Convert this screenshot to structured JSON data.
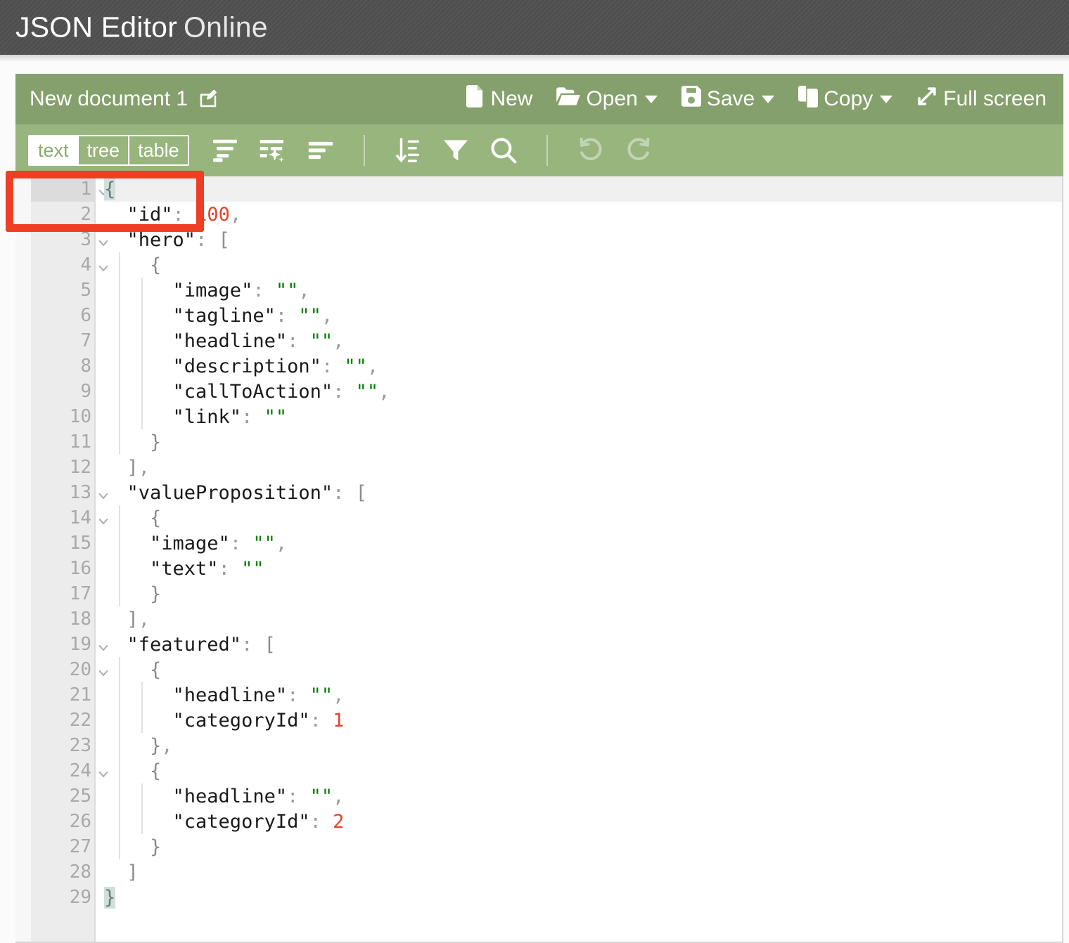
{
  "header": {
    "brand_strong": "JSON Editor",
    "brand_light": "Online"
  },
  "menu": {
    "document_name": "New document 1",
    "edit_icon": "pencil-square-icon",
    "actions": [
      {
        "label": "New",
        "icon": "file-icon",
        "has_caret": false
      },
      {
        "label": "Open",
        "icon": "folder-open-icon",
        "has_caret": true
      },
      {
        "label": "Save",
        "icon": "floppy-disk-icon",
        "has_caret": true
      },
      {
        "label": "Copy",
        "icon": "copy-icon",
        "has_caret": true
      },
      {
        "label": "Full screen",
        "icon": "expand-arrows-icon",
        "has_caret": false
      }
    ]
  },
  "toolbar": {
    "modes": [
      {
        "label": "text",
        "active": true
      },
      {
        "label": "tree",
        "active": false
      },
      {
        "label": "table",
        "active": false
      }
    ],
    "tools": [
      {
        "name": "format-icon",
        "disabled": false
      },
      {
        "name": "auto-format-icon",
        "disabled": false
      },
      {
        "name": "compact-icon",
        "disabled": false
      },
      {
        "name": "sort-icon",
        "disabled": false
      },
      {
        "name": "filter-icon",
        "disabled": false
      },
      {
        "name": "search-icon",
        "disabled": false
      },
      {
        "name": "undo-icon",
        "disabled": true
      },
      {
        "name": "redo-icon",
        "disabled": true
      }
    ],
    "highlight_color": "#ef3e23"
  },
  "colors": {
    "header_bg": "#4e4e4e",
    "menu_bg": "#85a06c",
    "toolbar_bg": "#97b57c",
    "string_value": "#008000",
    "number_value": "#e8412b",
    "highlight": "#ef3e23"
  },
  "editor": {
    "active_line": 1,
    "total_lines": 29,
    "lines": [
      {
        "n": 1,
        "fold": "open",
        "active": true,
        "tokens": [
          {
            "t": "match",
            "v": "{"
          }
        ]
      },
      {
        "n": 2,
        "fold": null,
        "active": false,
        "tokens": [
          {
            "t": "key",
            "v": "  \"id\""
          },
          {
            "t": "punct",
            "v": ": "
          },
          {
            "t": "num",
            "v": "100"
          },
          {
            "t": "punct",
            "v": ","
          }
        ]
      },
      {
        "n": 3,
        "fold": "open",
        "active": false,
        "tokens": [
          {
            "t": "key",
            "v": "  \"hero\""
          },
          {
            "t": "punct",
            "v": ": "
          },
          {
            "t": "brace",
            "v": "["
          }
        ]
      },
      {
        "n": 4,
        "fold": "open",
        "active": false,
        "tokens": [
          {
            "t": "brace",
            "v": "    {"
          }
        ]
      },
      {
        "n": 5,
        "fold": null,
        "active": false,
        "tokens": [
          {
            "t": "key",
            "v": "      \"image\""
          },
          {
            "t": "punct",
            "v": ": "
          },
          {
            "t": "str",
            "v": "\"\""
          },
          {
            "t": "punct",
            "v": ","
          }
        ]
      },
      {
        "n": 6,
        "fold": null,
        "active": false,
        "tokens": [
          {
            "t": "key",
            "v": "      \"tagline\""
          },
          {
            "t": "punct",
            "v": ": "
          },
          {
            "t": "str",
            "v": "\"\""
          },
          {
            "t": "punct",
            "v": ","
          }
        ]
      },
      {
        "n": 7,
        "fold": null,
        "active": false,
        "tokens": [
          {
            "t": "key",
            "v": "      \"headline\""
          },
          {
            "t": "punct",
            "v": ": "
          },
          {
            "t": "str",
            "v": "\"\""
          },
          {
            "t": "punct",
            "v": ","
          }
        ]
      },
      {
        "n": 8,
        "fold": null,
        "active": false,
        "tokens": [
          {
            "t": "key",
            "v": "      \"description\""
          },
          {
            "t": "punct",
            "v": ": "
          },
          {
            "t": "str",
            "v": "\"\""
          },
          {
            "t": "punct",
            "v": ","
          }
        ]
      },
      {
        "n": 9,
        "fold": null,
        "active": false,
        "tokens": [
          {
            "t": "key",
            "v": "      \"callToAction\""
          },
          {
            "t": "punct",
            "v": ": "
          },
          {
            "t": "str",
            "v": "\"\""
          },
          {
            "t": "punct",
            "v": ","
          }
        ]
      },
      {
        "n": 10,
        "fold": null,
        "active": false,
        "tokens": [
          {
            "t": "key",
            "v": "      \"link\""
          },
          {
            "t": "punct",
            "v": ": "
          },
          {
            "t": "str",
            "v": "\"\""
          }
        ]
      },
      {
        "n": 11,
        "fold": null,
        "active": false,
        "tokens": [
          {
            "t": "brace",
            "v": "    }"
          }
        ]
      },
      {
        "n": 12,
        "fold": null,
        "active": false,
        "tokens": [
          {
            "t": "brace",
            "v": "  ]"
          },
          {
            "t": "punct",
            "v": ","
          }
        ]
      },
      {
        "n": 13,
        "fold": "open",
        "active": false,
        "tokens": [
          {
            "t": "key",
            "v": "  \"valueProposition\""
          },
          {
            "t": "punct",
            "v": ": "
          },
          {
            "t": "brace",
            "v": "["
          }
        ]
      },
      {
        "n": 14,
        "fold": "open",
        "active": false,
        "tokens": [
          {
            "t": "brace",
            "v": "    {"
          }
        ]
      },
      {
        "n": 15,
        "fold": null,
        "active": false,
        "tokens": [
          {
            "t": "key",
            "v": "    \"image\""
          },
          {
            "t": "punct",
            "v": ": "
          },
          {
            "t": "str",
            "v": "\"\""
          },
          {
            "t": "punct",
            "v": ","
          }
        ]
      },
      {
        "n": 16,
        "fold": null,
        "active": false,
        "tokens": [
          {
            "t": "key",
            "v": "    \"text\""
          },
          {
            "t": "punct",
            "v": ": "
          },
          {
            "t": "str",
            "v": "\"\""
          }
        ]
      },
      {
        "n": 17,
        "fold": null,
        "active": false,
        "tokens": [
          {
            "t": "brace",
            "v": "    }"
          }
        ]
      },
      {
        "n": 18,
        "fold": null,
        "active": false,
        "tokens": [
          {
            "t": "brace",
            "v": "  ]"
          },
          {
            "t": "punct",
            "v": ","
          }
        ]
      },
      {
        "n": 19,
        "fold": "open",
        "active": false,
        "tokens": [
          {
            "t": "key",
            "v": "  \"featured\""
          },
          {
            "t": "punct",
            "v": ": "
          },
          {
            "t": "brace",
            "v": "["
          }
        ]
      },
      {
        "n": 20,
        "fold": "open",
        "active": false,
        "tokens": [
          {
            "t": "brace",
            "v": "    {"
          }
        ]
      },
      {
        "n": 21,
        "fold": null,
        "active": false,
        "tokens": [
          {
            "t": "key",
            "v": "      \"headline\""
          },
          {
            "t": "punct",
            "v": ": "
          },
          {
            "t": "str",
            "v": "\"\""
          },
          {
            "t": "punct",
            "v": ","
          }
        ]
      },
      {
        "n": 22,
        "fold": null,
        "active": false,
        "tokens": [
          {
            "t": "key",
            "v": "      \"categoryId\""
          },
          {
            "t": "punct",
            "v": ": "
          },
          {
            "t": "num",
            "v": "1"
          }
        ]
      },
      {
        "n": 23,
        "fold": null,
        "active": false,
        "tokens": [
          {
            "t": "brace",
            "v": "    }"
          },
          {
            "t": "punct",
            "v": ","
          }
        ]
      },
      {
        "n": 24,
        "fold": "open",
        "active": false,
        "tokens": [
          {
            "t": "brace",
            "v": "    {"
          }
        ]
      },
      {
        "n": 25,
        "fold": null,
        "active": false,
        "tokens": [
          {
            "t": "key",
            "v": "      \"headline\""
          },
          {
            "t": "punct",
            "v": ": "
          },
          {
            "t": "str",
            "v": "\"\""
          },
          {
            "t": "punct",
            "v": ","
          }
        ]
      },
      {
        "n": 26,
        "fold": null,
        "active": false,
        "tokens": [
          {
            "t": "key",
            "v": "      \"categoryId\""
          },
          {
            "t": "punct",
            "v": ": "
          },
          {
            "t": "num",
            "v": "2"
          }
        ]
      },
      {
        "n": 27,
        "fold": null,
        "active": false,
        "tokens": [
          {
            "t": "brace",
            "v": "    }"
          }
        ]
      },
      {
        "n": 28,
        "fold": null,
        "active": false,
        "tokens": [
          {
            "t": "brace",
            "v": "  ]"
          }
        ]
      },
      {
        "n": 29,
        "fold": null,
        "active": false,
        "tokens": [
          {
            "t": "match",
            "v": "}"
          }
        ]
      }
    ]
  }
}
